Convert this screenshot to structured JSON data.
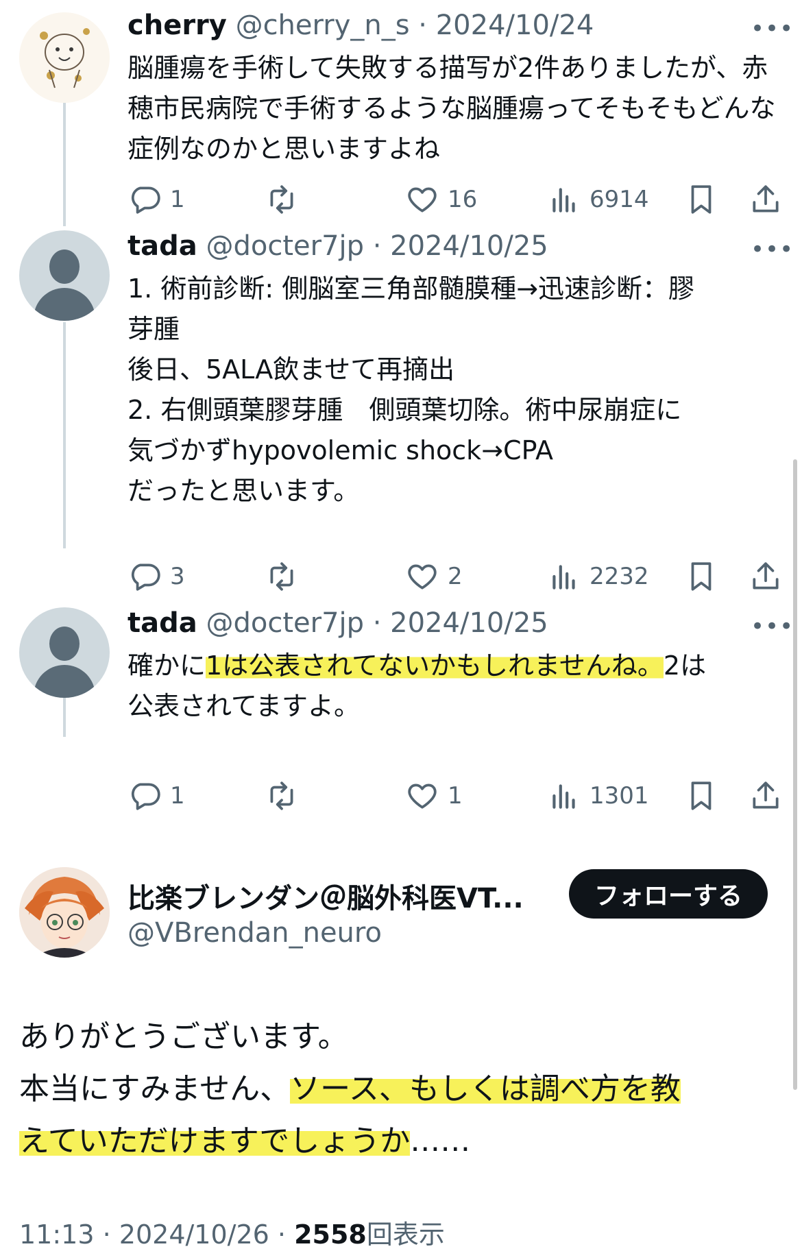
{
  "tweets": [
    {
      "name": "cherry",
      "handle": "@cherry_n_s",
      "date": "2024/10/24",
      "text_parts": [
        "脳腫瘍を手術して失敗する描写が2件ありましたが、赤穂市民病院で手術するような脳腫瘍ってそもそもどんな症例なのかと思いますよね"
      ],
      "replies": "1",
      "likes": "16",
      "views": "6914"
    },
    {
      "name": "tada",
      "handle": "@docter7jp",
      "date": "2024/10/25",
      "text_parts": [
        "1. 術前診断: 側脳室三角部髄膜種→迅速診断：膠\n芽腫\n後日、5ALA飲ませて再摘出\n2. 右側頭葉膠芽腫　側頭葉切除。術中尿崩症に\n気づかずhypovolemic shock→CPA\nだったと思います。"
      ],
      "replies": "3",
      "likes": "2",
      "views": "2232"
    },
    {
      "name": "tada",
      "handle": "@docter7jp",
      "date": "2024/10/25",
      "text_parts": [
        "確かに",
        "1は公表されてないかもしれませんね。",
        "2は\n公表されてますよ。"
      ],
      "replies": "1",
      "likes": "1",
      "views": "1301"
    }
  ],
  "main_post": {
    "name": "比楽ブレンダン＠脳外科医VT...",
    "handle": "@VBrendan_neuro",
    "follow_label": "フォローする",
    "text_parts": [
      "ありがとうございます。\n本当にすみません、",
      "ソース、もしくは調べ方を教\nえていただけますでしょうか",
      "……"
    ],
    "time": "11:13",
    "date": "2024/10/26",
    "views_count": "2558",
    "views_label": "回表示"
  },
  "separator": "·",
  "more_glyph": "•••",
  "icons": [
    "reply-icon",
    "retweet-icon",
    "like-icon",
    "views-icon",
    "bookmark-icon",
    "share-icon"
  ],
  "colors": {
    "text": "#0f1419",
    "muted": "#536471",
    "highlight": "#f7f15a",
    "follow_button": "#0f1419"
  }
}
